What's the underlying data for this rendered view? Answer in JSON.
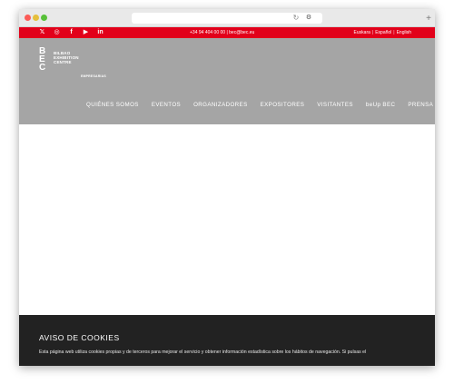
{
  "browser": {
    "reload_icon": "↻",
    "extension_icon": "⚙",
    "new_tab_icon": "+"
  },
  "topbar": {
    "social": [
      "𝕏",
      "◎",
      "f",
      "▶",
      "in"
    ],
    "contact": "+34 94 404 00 00  |  bec@bec.eu",
    "languages": [
      "Euskara",
      "Español",
      "English"
    ],
    "color": "#e2001a"
  },
  "header": {
    "logo_letters": [
      "B",
      "E",
      "C"
    ],
    "logo_lines": [
      "BILBAO",
      "EXHIBITION",
      "CENTRE"
    ],
    "logo_sub": "EMPRESARIAS",
    "nav": [
      "QUIÉNES SOMOS",
      "EVENTOS",
      "ORGANIZADORES",
      "EXPOSITORES",
      "VISITANTES",
      "beUp BEC",
      "PRENSA"
    ],
    "search_icon": "🔍︎",
    "background": "#a5a5a5"
  },
  "cookie": {
    "title": "AVISO DE COOKIES",
    "text": "Esta página web utiliza cookies propias y de terceros para mejorar el servicio y obtener información estadística sobre los hábitos de navegación. Si pulsas el"
  }
}
